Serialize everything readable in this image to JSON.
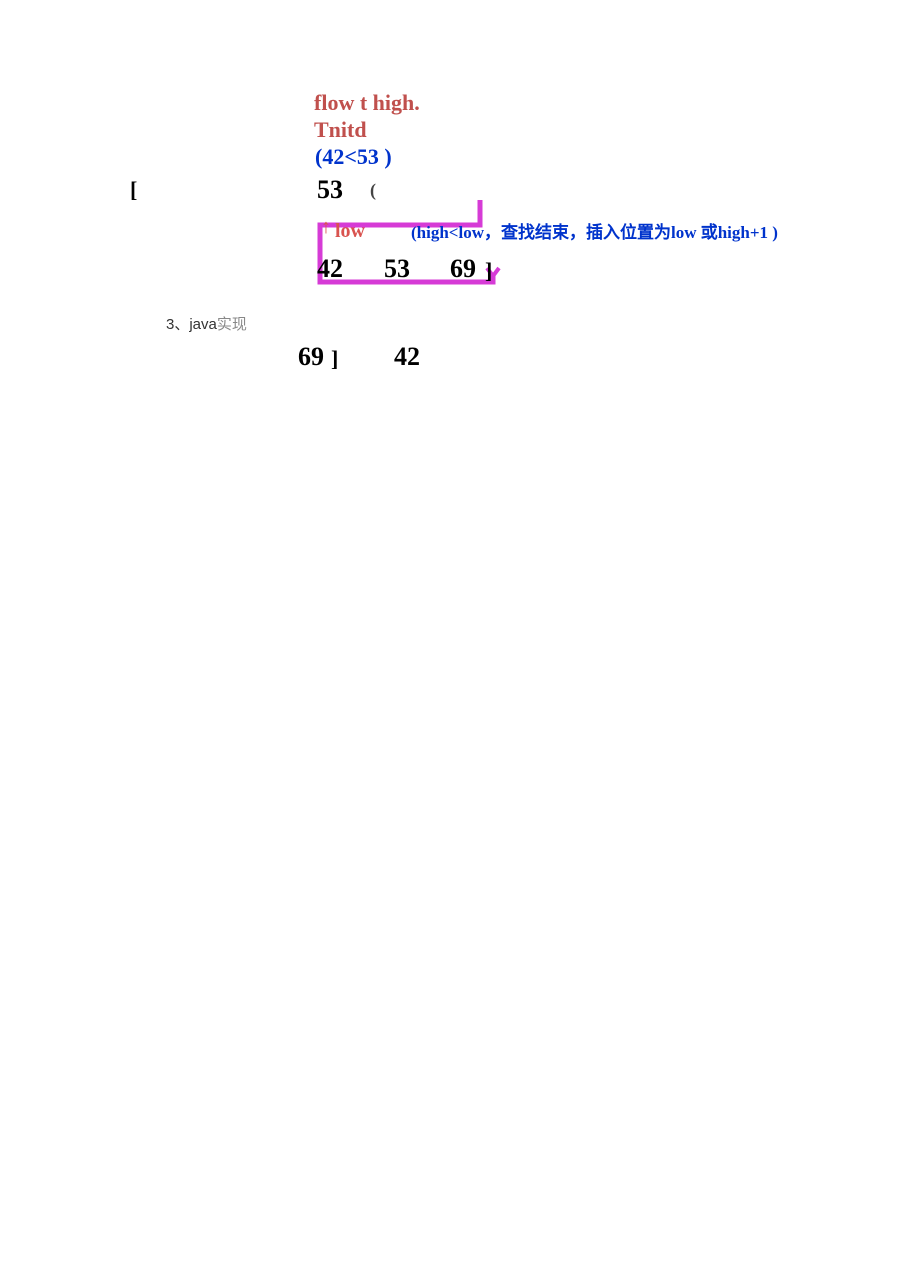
{
  "title": {
    "line1": "flow t high.",
    "line2": "Tnitd"
  },
  "condition": "(42<53 )",
  "top_row": {
    "bracket_left": "[",
    "num": "53",
    "paren": "("
  },
  "pointer": {
    "arrow": "↑",
    "label": "low"
  },
  "note": "(high<low，查找结束，插入位置为low 或high+1 )",
  "result_row": {
    "v1": "42",
    "v2": "53",
    "v3": "69",
    "bracket_right": "]"
  },
  "section": {
    "prefix": "3、java",
    "suffix": "实现"
  },
  "bottom_row": {
    "v1": "69",
    "bracket": "]",
    "v2": "42"
  }
}
